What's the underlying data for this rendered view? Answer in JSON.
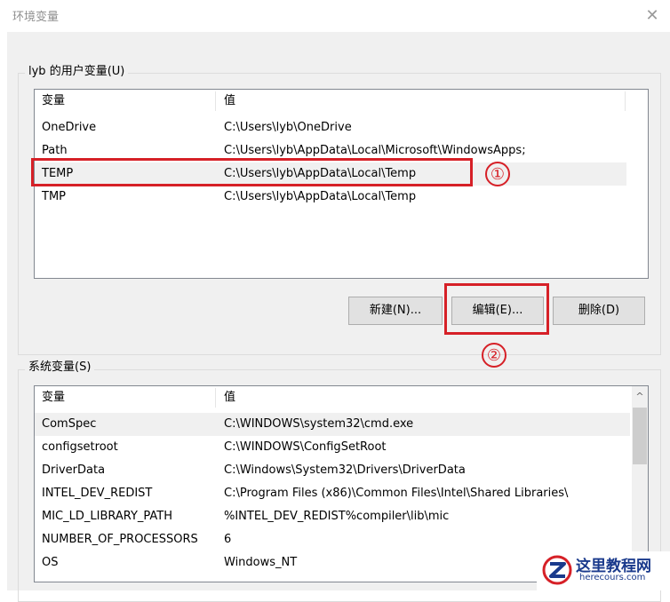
{
  "window": {
    "title": "环境变量",
    "close_glyph": "✕"
  },
  "user_vars": {
    "group_label": "lyb 的用户变量(U)",
    "columns": [
      "变量",
      "值"
    ],
    "rows": [
      {
        "name": "OneDrive",
        "value": "C:\\Users\\lyb\\OneDrive"
      },
      {
        "name": "Path",
        "value": "C:\\Users\\lyb\\AppData\\Local\\Microsoft\\WindowsApps;"
      },
      {
        "name": "TEMP",
        "value": "C:\\Users\\lyb\\AppData\\Local\\Temp",
        "selected": true
      },
      {
        "name": "TMP",
        "value": "C:\\Users\\lyb\\AppData\\Local\\Temp"
      }
    ],
    "buttons": {
      "new": "新建(N)...",
      "edit": "编辑(E)...",
      "delete": "删除(D)"
    }
  },
  "annotations": {
    "step1": "①",
    "step2": "②",
    "highlight_color": "#d62027"
  },
  "system_vars": {
    "group_label": "系统变量(S)",
    "columns": [
      "变量",
      "值"
    ],
    "rows": [
      {
        "name": "ComSpec",
        "value": "C:\\WINDOWS\\system32\\cmd.exe",
        "selected": true
      },
      {
        "name": "configsetroot",
        "value": "C:\\WINDOWS\\ConfigSetRoot"
      },
      {
        "name": "DriverData",
        "value": "C:\\Windows\\System32\\Drivers\\DriverData"
      },
      {
        "name": "INTEL_DEV_REDIST",
        "value": "C:\\Program Files (x86)\\Common Files\\Intel\\Shared Libraries\\"
      },
      {
        "name": "MIC_LD_LIBRARY_PATH",
        "value": "%INTEL_DEV_REDIST%compiler\\lib\\mic"
      },
      {
        "name": "NUMBER_OF_PROCESSORS",
        "value": "6"
      },
      {
        "name": "OS",
        "value": "Windows_NT"
      }
    ],
    "scroll_up_glyph": "^"
  },
  "watermark": {
    "title": "这里教程网",
    "url": "herecours.com"
  }
}
